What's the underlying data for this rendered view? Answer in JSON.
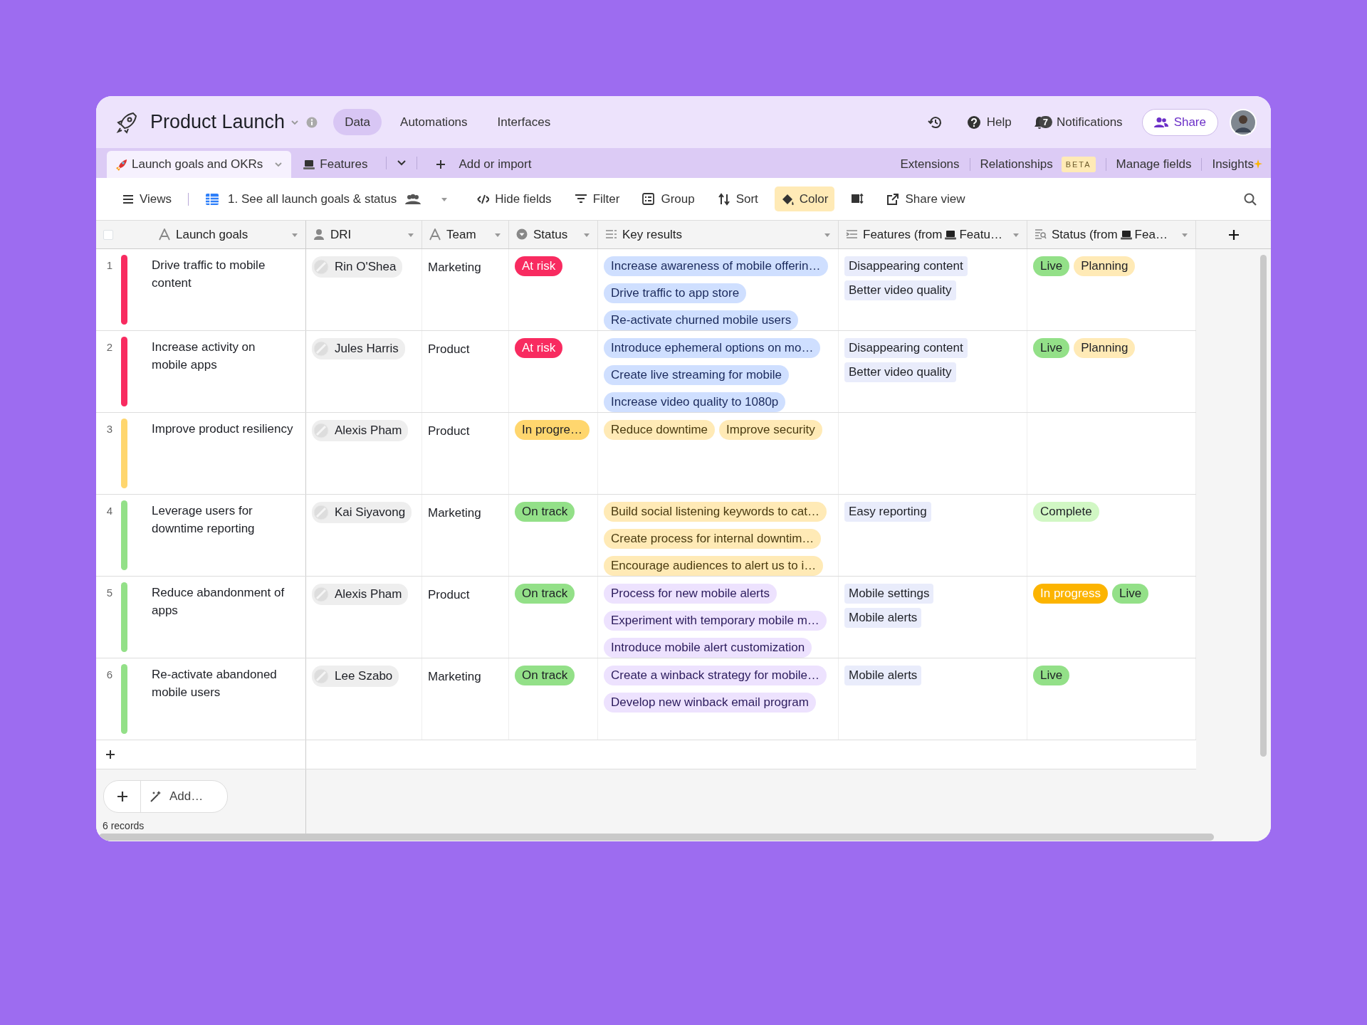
{
  "base": {
    "title": "Product Launch"
  },
  "nav": [
    {
      "label": "Data",
      "selected": true
    },
    {
      "label": "Automations",
      "selected": false
    },
    {
      "label": "Interfaces",
      "selected": false
    }
  ],
  "account": {
    "help": "Help",
    "notification_count": "7",
    "notifications": "Notifications",
    "share": "Share"
  },
  "tables": [
    {
      "label": "Launch goals and OKRs",
      "kind": "rocket",
      "selected": true
    },
    {
      "label": "Features",
      "kind": "laptop",
      "selected": false
    }
  ],
  "add_table": "Add or import",
  "table_links": [
    {
      "label": "Extensions"
    },
    {
      "label": "Relationships",
      "badge": "BETA"
    },
    {
      "label": "Manage fields"
    },
    {
      "label": "Insights",
      "kind": "sparkle"
    }
  ],
  "toolbar": {
    "views": "Views",
    "view_name": "1. See all launch goals & status",
    "items": [
      {
        "kind": "hide",
        "label": "Hide fields",
        "selected": false
      },
      {
        "kind": "filter",
        "label": "Filter",
        "selected": false
      },
      {
        "kind": "group",
        "label": "Group",
        "selected": false
      },
      {
        "kind": "sort",
        "label": "Sort",
        "selected": false
      },
      {
        "kind": "color",
        "label": "Color",
        "selected": true
      },
      {
        "kind": "height",
        "selected": false
      },
      {
        "kind": "share",
        "label": "Share view",
        "selected": false
      }
    ]
  },
  "select_all": {
    "checked": false
  },
  "columns": [
    {
      "label": "Launch goals",
      "kind": "text"
    },
    {
      "label": "DRI",
      "kind": "user"
    },
    {
      "label": "Team",
      "kind": "text"
    },
    {
      "label": "Status",
      "kind": "select"
    },
    {
      "label": "Key results",
      "kind": "links"
    },
    {
      "label": "Features (from",
      "linked": "Featu…",
      "kind": "lookup"
    },
    {
      "label": "Status (from",
      "linked": "Fea…",
      "kind": "search"
    }
  ],
  "rows": [
    {
      "number": "1",
      "color": "#f82b60",
      "goal": "Drive traffic to mobile content",
      "dri": "Rin O'Shea",
      "team": "Marketing",
      "status": {
        "label": "At risk",
        "color": "#f82b60"
      },
      "key_results": [
        {
          "label": "Increase awareness of mobile offerin…",
          "color": "#cfdfff"
        },
        {
          "label": "Drive traffic to app store",
          "color": "#cfdfff"
        },
        {
          "label": "Re-activate churned mobile users",
          "color": "#cfdfff"
        }
      ],
      "features": [
        "Disappearing content",
        "Better video quality"
      ],
      "feature_status": [
        {
          "label": "Live",
          "color": "#93e088"
        },
        {
          "label": "Planning",
          "color": "#ffeab6"
        }
      ]
    },
    {
      "number": "2",
      "color": "#f82b60",
      "goal": "Increase activity on mobile apps",
      "dri": "Jules Harris",
      "team": "Product",
      "status": {
        "label": "At risk",
        "color": "#f82b60"
      },
      "key_results": [
        {
          "label": "Introduce ephemeral options on mo…",
          "color": "#cfdfff"
        },
        {
          "label": "Create live streaming for mobile",
          "color": "#cfdfff"
        },
        {
          "label": "Increase video quality to 1080p",
          "color": "#cfdfff"
        }
      ],
      "features": [
        "Disappearing content",
        "Better video quality"
      ],
      "feature_status": [
        {
          "label": "Live",
          "color": "#93e088"
        },
        {
          "label": "Planning",
          "color": "#ffeab6"
        }
      ]
    },
    {
      "number": "3",
      "color": "#ffd66e",
      "goal": "Improve product resiliency",
      "dri": "Alexis Pham",
      "team": "Product",
      "status": {
        "label": "In progre…",
        "color": "#ffd66e"
      },
      "key_results": [
        {
          "label": "Reduce downtime",
          "color": "#ffeab6"
        },
        {
          "label": "Improve security",
          "color": "#ffeab6"
        }
      ],
      "features": [],
      "feature_status": []
    },
    {
      "number": "4",
      "color": "#93e088",
      "goal": "Leverage users for downtime reporting",
      "dri": "Kai Siyavong",
      "team": "Marketing",
      "status": {
        "label": "On track",
        "color": "#93e088"
      },
      "key_results": [
        {
          "label": "Build social listening keywords to cat…",
          "color": "#ffeab6"
        },
        {
          "label": "Create process for internal downtim…",
          "color": "#ffeab6"
        },
        {
          "label": "Encourage audiences to alert us to i…",
          "color": "#ffeab6"
        }
      ],
      "features": [
        "Easy reporting"
      ],
      "feature_status": [
        {
          "label": "Complete",
          "color": "#d1f7c4"
        }
      ]
    },
    {
      "number": "5",
      "color": "#93e088",
      "goal": "Reduce abandonment of apps",
      "dri": "Alexis Pham",
      "team": "Product",
      "status": {
        "label": "On track",
        "color": "#93e088"
      },
      "key_results": [
        {
          "label": "Process for new mobile alerts",
          "color": "#ede2fe"
        },
        {
          "label": "Experiment with temporary mobile m…",
          "color": "#ede2fe"
        },
        {
          "label": "Introduce mobile alert customization",
          "color": "#ede2fe"
        }
      ],
      "features": [
        "Mobile settings",
        "Mobile alerts"
      ],
      "feature_status": [
        {
          "label": "In progress",
          "color": "#fcb400"
        },
        {
          "label": "Live",
          "color": "#93e088"
        }
      ]
    },
    {
      "number": "6",
      "color": "#93e088",
      "goal": "Re-activate abandoned mobile users",
      "dri": "Lee Szabo",
      "team": "Marketing",
      "status": {
        "label": "On track",
        "color": "#93e088"
      },
      "key_results": [
        {
          "label": "Create a winback strategy for mobile…",
          "color": "#ede2fe"
        },
        {
          "label": "Develop new winback email program",
          "color": "#ede2fe"
        }
      ],
      "features": [
        "Mobile alerts"
      ],
      "feature_status": [
        {
          "label": "Live",
          "color": "#93e088"
        }
      ]
    }
  ],
  "footer": {
    "add": "Add…",
    "records": "6 records"
  }
}
